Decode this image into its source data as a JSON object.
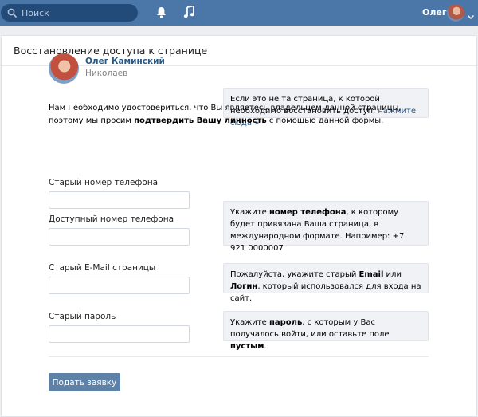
{
  "topbar": {
    "search_placeholder": "Поиск",
    "user_name": "Олег"
  },
  "page": {
    "title": "Восстановление доступа к странице"
  },
  "profile": {
    "name": "Олег Каминский",
    "city": "Николаев"
  },
  "not_your_page": {
    "text_1": "Если это не та страница, к которой необходимо восстановить доступ, ",
    "link": "нажмите сюда »"
  },
  "intro": {
    "part_1": "Нам необходимо удостовериться, что Вы являетесь владельцем данной страницы, поэтому мы просим ",
    "bold": "подтвердить Вашу личность",
    "part_2": " с помощью данной формы."
  },
  "fields": {
    "old_phone_label": "Старый номер телефона",
    "new_phone_label": "Доступный номер телефона",
    "old_email_label": "Старый E-Mail страницы",
    "old_password_label": "Старый пароль"
  },
  "hints": {
    "phone": {
      "part_1": "Укажите ",
      "bold_1": "номер телефона",
      "part_2": ", к которому будет привязана Ваша страница, в международном формате. Например: +7 921 0000007"
    },
    "email": {
      "part_1": "Пожалуйста, укажите старый ",
      "bold_1": "Email",
      "part_2": " или ",
      "bold_2": "Логин",
      "part_3": ", который использовался для входа на сайт."
    },
    "password": {
      "part_1": "Укажите ",
      "bold_1": "пароль",
      "part_2": ", с которым у Вас получалось войти, или оставьте поле ",
      "bold_2": "пустым",
      "part_3": "."
    }
  },
  "submit_label": "Подать заявку",
  "colors": {
    "topbar": "#4a76a8",
    "link": "#2a5885",
    "button": "#5e81a8"
  }
}
